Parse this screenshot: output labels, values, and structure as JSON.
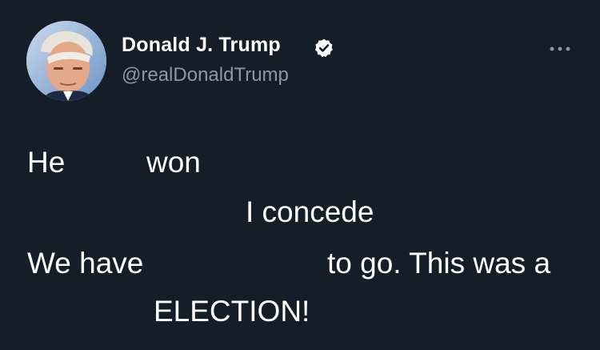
{
  "author": {
    "display_name": "Donald J. Trump",
    "handle": "@realDonaldTrump",
    "verified": true
  },
  "tweet": {
    "fragments": [
      "He",
      "won",
      "I concede",
      "We have",
      "to go. This was a",
      "ELECTION!"
    ]
  },
  "icons": {
    "avatar": "profile-photo",
    "verified": "verified-badge-icon",
    "more": "more-options-icon"
  },
  "colors": {
    "background": "#151d28",
    "text": "#ffffff",
    "handle": "#8b98a5"
  }
}
